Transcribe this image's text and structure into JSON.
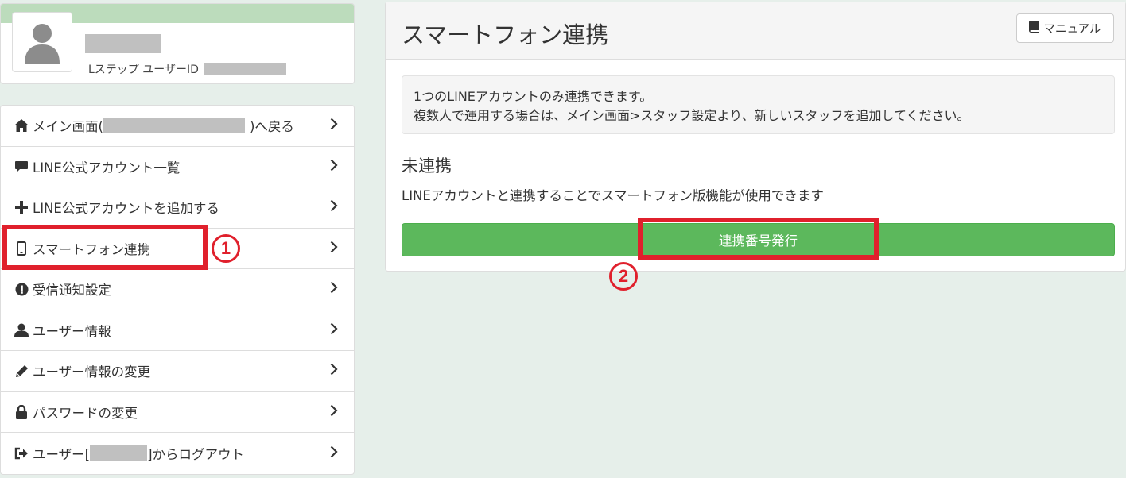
{
  "profile": {
    "id_label": "Lステップ ユーザーID"
  },
  "menu": {
    "items": [
      {
        "icon": "home-icon",
        "label_pre": "メイン画面(",
        "label_post": ")へ戻る"
      },
      {
        "icon": "chat-bubble-icon",
        "label": "LINE公式アカウント一覧"
      },
      {
        "icon": "plus-icon",
        "label": "LINE公式アカウントを追加する"
      },
      {
        "icon": "smartphone-icon",
        "label": "スマートフォン連携"
      },
      {
        "icon": "exclamation-circle-icon",
        "label": "受信通知設定"
      },
      {
        "icon": "user-icon",
        "label": "ユーザー情報"
      },
      {
        "icon": "pencil-icon",
        "label": "ユーザー情報の変更"
      },
      {
        "icon": "lock-icon",
        "label": "パスワードの変更"
      },
      {
        "icon": "logout-icon",
        "label_pre": "ユーザー[",
        "label_post": "]からログアウト"
      }
    ]
  },
  "panel": {
    "title": "スマートフォン連携",
    "manual_button": "マニュアル",
    "notice_line1": "1つのLINEアカウントのみ連携できます。",
    "notice_line2": "複数人で運用する場合は、メイン画面>スタッフ設定より、新しいスタッフを追加してください。",
    "status_title": "未連携",
    "status_desc": "LINEアカウントと連携することでスマートフォン版機能が使用できます",
    "issue_button": "連携番号発行"
  },
  "annotations": {
    "step1": "1",
    "step2": "2",
    "color": "#e0202c"
  },
  "colors": {
    "button_green": "#5cb85c",
    "band_green": "#bcdcbc",
    "background": "#e6efea"
  }
}
